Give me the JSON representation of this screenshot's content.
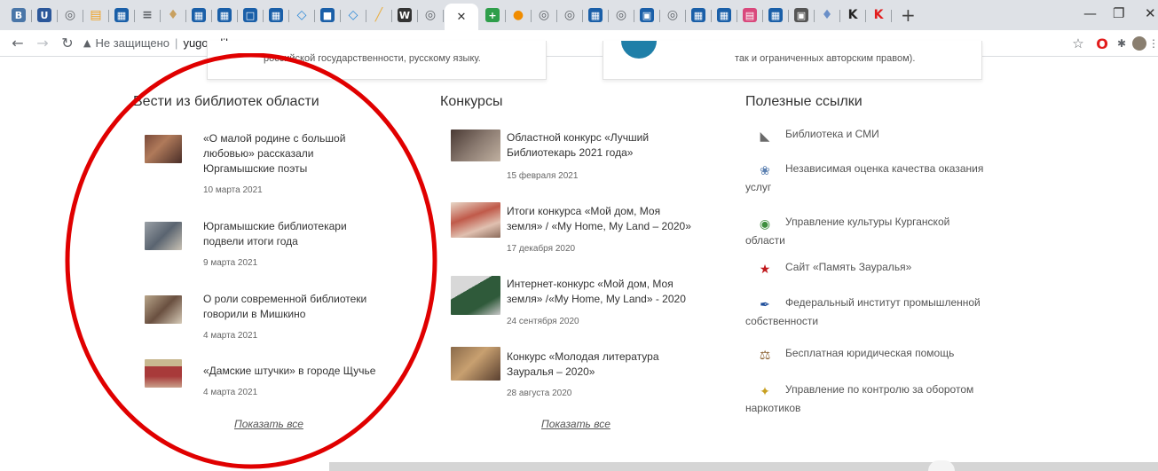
{
  "browser": {
    "tabs": [
      {
        "icon": "vk-icon",
        "glyph": "B",
        "color": "#4a76a8"
      },
      {
        "icon": "bookmark-app-icon",
        "glyph": "U",
        "color": "#2b579a"
      },
      {
        "icon": "globe-icon",
        "glyph": "◎",
        "color": "#5f6368"
      },
      {
        "icon": "books-icon",
        "glyph": "▤",
        "color": "#f0a020"
      },
      {
        "icon": "grid-app-icon",
        "glyph": "▦",
        "color": "#1a5fa8"
      },
      {
        "icon": "layers-icon",
        "glyph": "≡",
        "color": "#5f6368"
      },
      {
        "icon": "emblem-icon",
        "glyph": "♦",
        "color": "#c8a060"
      },
      {
        "icon": "grid-app-icon",
        "glyph": "▦",
        "color": "#1a5fa8"
      },
      {
        "icon": "grid-app-icon",
        "glyph": "▦",
        "color": "#1a5fa8"
      },
      {
        "icon": "book-open-icon",
        "glyph": "□",
        "color": "#1a5fa8"
      },
      {
        "icon": "grid-app-icon",
        "glyph": "▦",
        "color": "#1a5fa8"
      },
      {
        "icon": "diamond-icon",
        "glyph": "◇",
        "color": "#2b88d8"
      },
      {
        "icon": "panel-icon",
        "glyph": "■",
        "color": "#1a5fa8"
      },
      {
        "icon": "diamond-icon",
        "glyph": "◇",
        "color": "#2b88d8"
      },
      {
        "icon": "chart-icon",
        "glyph": "╱",
        "color": "#e8b04a"
      },
      {
        "icon": "wix-icon",
        "glyph": "W",
        "color": "#333333"
      },
      {
        "icon": "globe-icon",
        "glyph": "◎",
        "color": "#5f6368"
      },
      {
        "icon": "plus-square-icon",
        "glyph": "+",
        "color": "#2e9e4a"
      },
      {
        "icon": "paint-icon",
        "glyph": "●",
        "color": "#f08c00"
      },
      {
        "icon": "globe-icon",
        "glyph": "◎",
        "color": "#5f6368"
      },
      {
        "icon": "globe-icon",
        "glyph": "◎",
        "color": "#5f6368"
      },
      {
        "icon": "grid-app-icon",
        "glyph": "▦",
        "color": "#1a5fa8"
      },
      {
        "icon": "globe-icon",
        "glyph": "◎",
        "color": "#5f6368"
      },
      {
        "icon": "building-icon",
        "glyph": "▣",
        "color": "#1a5fa8"
      },
      {
        "icon": "globe-icon",
        "glyph": "◎",
        "color": "#5f6368"
      },
      {
        "icon": "grid-app-icon",
        "glyph": "▦",
        "color": "#1a5fa8"
      },
      {
        "icon": "grid-app-icon",
        "glyph": "▦",
        "color": "#1a5fa8"
      },
      {
        "icon": "document-icon",
        "glyph": "▤",
        "color": "#d9487c"
      },
      {
        "icon": "grid-app-icon",
        "glyph": "▦",
        "color": "#1a5fa8"
      },
      {
        "icon": "image-icon",
        "glyph": "▣",
        "color": "#555555"
      },
      {
        "icon": "emblem-icon",
        "glyph": "♦",
        "color": "#6a8fc8"
      },
      {
        "icon": "k-letter-icon",
        "glyph": "K",
        "color": "#222222"
      },
      {
        "icon": "k-letter-icon",
        "glyph": "K",
        "color": "#e21c1c"
      }
    ],
    "url_warning": "Не защищено",
    "url": "yugovalib.ru"
  },
  "cards": {
    "left_text": "российской государственности, русскому языку.",
    "right_text": "так и ограниченных авторским правом)."
  },
  "columns": {
    "news": {
      "title": "Вести из библиотек области",
      "items": [
        {
          "title_lines": [
            "«О малой родине с большой",
            "любовью» рассказали",
            "Юргамышские поэты"
          ],
          "date": "10 марта 2021"
        },
        {
          "title_lines": [
            "Юргамышские библиотекари",
            "подвели итоги года"
          ],
          "date": "9 марта 2021"
        },
        {
          "title_lines": [
            "О роли современной библиотеки",
            "говорили в Мишкино"
          ],
          "date": "4 марта 2021"
        },
        {
          "title_lines": [
            "«Дамские штучки» в городе Щучье"
          ],
          "date": "4 марта 2021"
        }
      ],
      "show_all": "Показать все"
    },
    "contests": {
      "title": "Конкурсы",
      "items": [
        {
          "title_lines": [
            "Областной конкурс «Лучший",
            "Библиотекарь 2021 года»"
          ],
          "date": "15 февраля 2021"
        },
        {
          "title_lines": [
            "Итоги конкурса «Мой дом, Моя",
            "земля» / «My Home, My Land – 2020»"
          ],
          "date": "17 декабря 2020"
        },
        {
          "title_lines": [
            "Интернет-конкурс «Мой дом, Моя",
            "земля» /«My Home, My Land» - 2020"
          ],
          "date": "24 сентября 2020"
        },
        {
          "title_lines": [
            "Конкурс «Молодая литература",
            "Зауралья – 2020»"
          ],
          "date": "28 августа 2020"
        }
      ],
      "show_all": "Показать все"
    },
    "links": {
      "title": "Полезные ссылки",
      "items": [
        {
          "icon": "book-stack-icon",
          "glyph": "◣",
          "color": "#6a6a6a",
          "lines": [
            "Библиотека и СМИ"
          ]
        },
        {
          "icon": "emblem-icon",
          "glyph": "❀",
          "color": "#5a7fb0",
          "lines": [
            "Независимая оценка качества оказания",
            "услуг"
          ]
        },
        {
          "icon": "coat-of-arms-icon",
          "glyph": "◉",
          "color": "#3f8f3f",
          "lines": [
            "Управление культуры Курганской",
            "области"
          ]
        },
        {
          "icon": "star-icon",
          "glyph": "★",
          "color": "#c0181c",
          "lines": [
            "Сайт «Память Зауралья»"
          ]
        },
        {
          "icon": "patent-icon",
          "glyph": "✒",
          "color": "#1d4d9a",
          "lines": [
            "Федеральный институт промышленной",
            "собственности"
          ]
        },
        {
          "icon": "scales-icon",
          "glyph": "⚖",
          "color": "#8a6030",
          "lines": [
            "Бесплатная юридическая помощь"
          ]
        },
        {
          "icon": "eagle-icon",
          "glyph": "✦",
          "color": "#c8a020",
          "lines": [
            "Управление по контролю за оборотом",
            "наркотиков"
          ]
        }
      ]
    }
  }
}
